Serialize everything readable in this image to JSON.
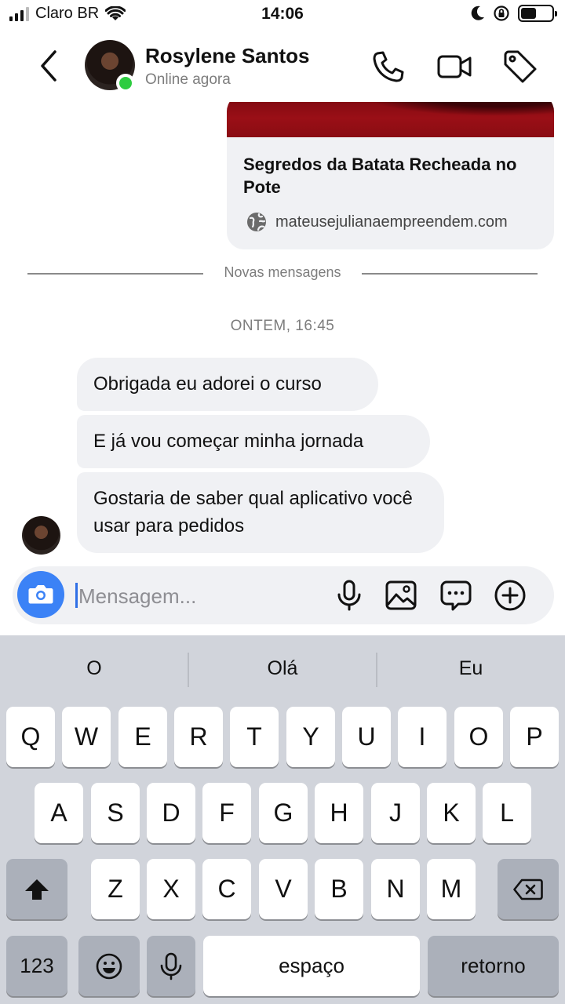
{
  "status_bar": {
    "carrier": "Claro BR",
    "time": "14:06"
  },
  "header": {
    "contact_name": "Rosylene Santos",
    "contact_status": "Online agora"
  },
  "chat": {
    "link_card": {
      "title": "Segredos da Batata Recheada no Pote",
      "domain": "mateusejulianaempreendem.com"
    },
    "divider_label": "Novas mensagens",
    "timestamp": "ONTEM, 16:45",
    "messages": [
      {
        "text": "Obrigada eu adorei o curso"
      },
      {
        "text": "E já vou começar  minha jornada"
      },
      {
        "text": "Gostaria de saber qual aplicativo você usar para pedidos"
      }
    ]
  },
  "composer": {
    "placeholder": "Mensagem..."
  },
  "keyboard": {
    "suggestions": [
      "O",
      "Olá",
      "Eu"
    ],
    "row1": [
      "Q",
      "W",
      "E",
      "R",
      "T",
      "Y",
      "U",
      "I",
      "O",
      "P"
    ],
    "row2": [
      "A",
      "S",
      "D",
      "F",
      "G",
      "H",
      "J",
      "K",
      "L"
    ],
    "row3": [
      "Z",
      "X",
      "C",
      "V",
      "B",
      "N",
      "M"
    ],
    "numbers_label": "123",
    "space_label": "espaço",
    "return_label": "retorno"
  },
  "colors": {
    "accent": "#3b82f6",
    "online": "#2ecc40",
    "bubble": "#f0f1f4",
    "keyboard_bg": "#d1d4db"
  },
  "icons": [
    "back-icon",
    "phone-icon",
    "video-icon",
    "tag-icon",
    "globe-icon",
    "camera-icon",
    "microphone-icon",
    "image-icon",
    "message-icon",
    "plus-icon",
    "shift-icon",
    "backspace-icon",
    "emoji-icon",
    "dictation-icon"
  ]
}
